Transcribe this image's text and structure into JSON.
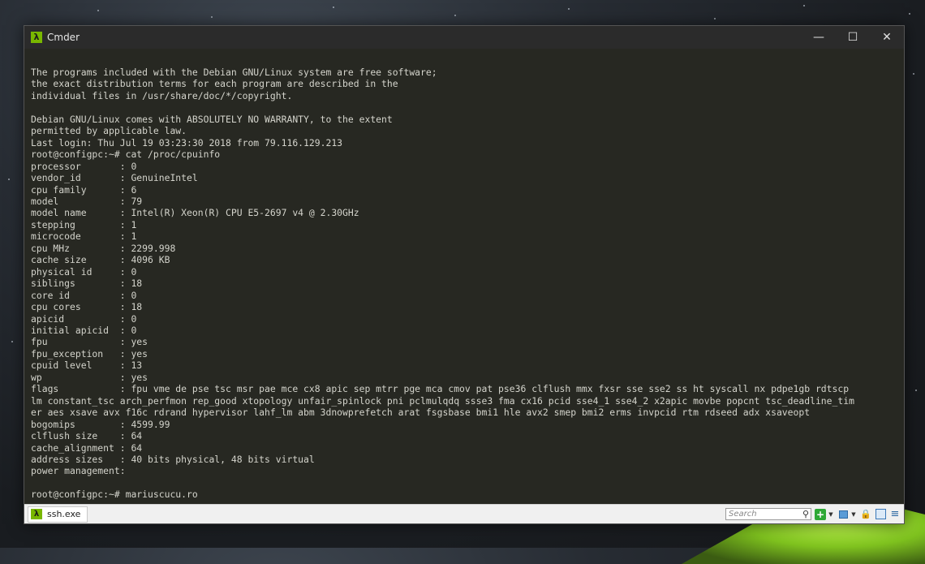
{
  "window": {
    "title": "Cmder",
    "icon": "lambda-icon",
    "controls": {
      "minimize": "—",
      "maximize": "☐",
      "close": "✕"
    }
  },
  "terminal": {
    "lines": [
      "The programs included with the Debian GNU/Linux system are free software;",
      "the exact distribution terms for each program are described in the",
      "individual files in /usr/share/doc/*/copyright.",
      "",
      "Debian GNU/Linux comes with ABSOLUTELY NO WARRANTY, to the extent",
      "permitted by applicable law.",
      "Last login: Thu Jul 19 03:23:30 2018 from 79.116.129.213",
      "root@configpc:~# cat /proc/cpuinfo",
      "processor       : 0",
      "vendor_id       : GenuineIntel",
      "cpu family      : 6",
      "model           : 79",
      "model name      : Intel(R) Xeon(R) CPU E5-2697 v4 @ 2.30GHz",
      "stepping        : 1",
      "microcode       : 1",
      "cpu MHz         : 2299.998",
      "cache size      : 4096 KB",
      "physical id     : 0",
      "siblings        : 18",
      "core id         : 0",
      "cpu cores       : 18",
      "apicid          : 0",
      "initial apicid  : 0",
      "fpu             : yes",
      "fpu_exception   : yes",
      "cpuid level     : 13",
      "wp              : yes",
      "flags           : fpu vme de pse tsc msr pae mce cx8 apic sep mtrr pge mca cmov pat pse36 clflush mmx fxsr sse sse2 ss ht syscall nx pdpe1gb rdtscp",
      "lm constant_tsc arch_perfmon rep_good xtopology unfair_spinlock pni pclmulqdq ssse3 fma cx16 pcid sse4_1 sse4_2 x2apic movbe popcnt tsc_deadline_tim",
      "er aes xsave avx f16c rdrand hypervisor lahf_lm abm 3dnowprefetch arat fsgsbase bmi1 hle avx2 smep bmi2 erms invpcid rtm rdseed adx xsaveopt",
      "bogomips        : 4599.99",
      "clflush size    : 64",
      "cache_alignment : 64",
      "address sizes   : 40 bits physical, 48 bits virtual",
      "power management:",
      "",
      "root@configpc:~# mariuscucu.ro"
    ]
  },
  "statusbar": {
    "tab_label": "ssh.exe",
    "search_placeholder": "Search",
    "tools": [
      "add-console-icon",
      "monitor-icon",
      "lock-icon",
      "split-view-icon",
      "menu-icon"
    ]
  },
  "colors": {
    "terminal_bg": "#272822",
    "terminal_fg": "#d4d4cc",
    "accent": "#79b700"
  }
}
